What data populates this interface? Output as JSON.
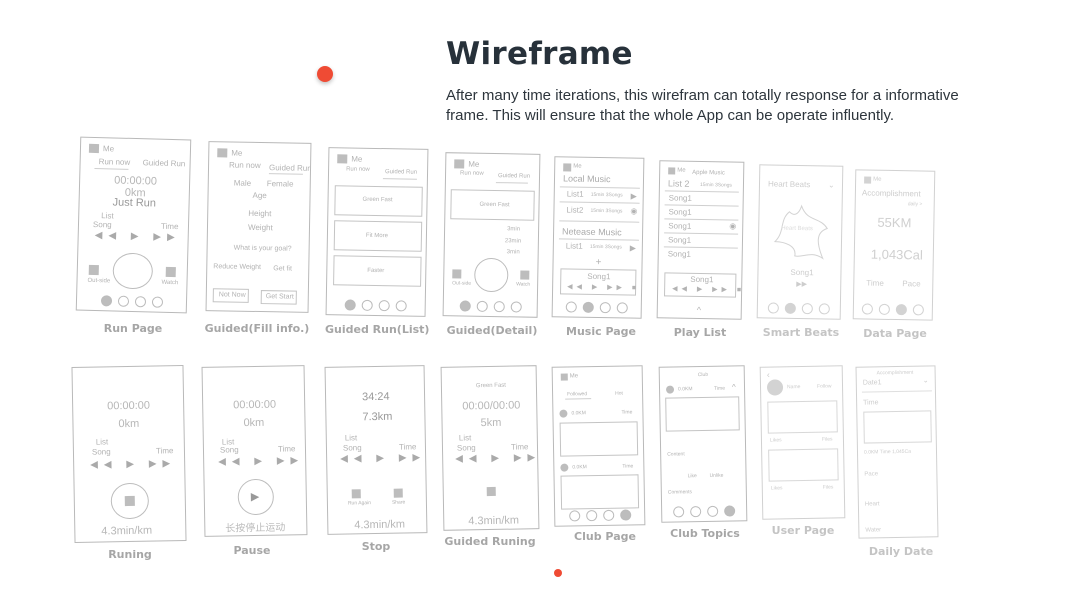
{
  "heading": {
    "title": "Wireframe",
    "description": "After many time iterations, this wirefram can totally response for a informative frame. This will ensure that the whole App can be operate influently."
  },
  "labels": {
    "run_page": "Run Page",
    "guided_fill": "Guided(Fill info.)",
    "guided_run_list": "Guided Run(List)",
    "guided_detail": "Guided(Detail)",
    "music_page": "Music Page",
    "play_list": "Play List",
    "smart_beats": "Smart Beats",
    "data_page": "Data Page",
    "runing": "Runing",
    "pause": "Pause",
    "stop": "Stop",
    "guided_runing": "Guided Runing",
    "club_page": "Club Page",
    "club_topics": "Club Topics",
    "user_page": "User Page",
    "daily_date": "Daily Date"
  },
  "screens": {
    "run": {
      "me": "Me",
      "tab1": "Run now",
      "tab2": "Guided Run",
      "timer": "00:00:00",
      "dist": "0km",
      "main": "Just Run",
      "list": "List",
      "song": "Song",
      "time": "Time",
      "outside": "Out-side",
      "watch": "Watch"
    },
    "fill": {
      "me": "Me",
      "tab1": "Run now",
      "tab2": "Guided Run",
      "male": "Male",
      "female": "Female",
      "age": "Age",
      "height": "Height",
      "weight": "Weight",
      "goal": "What is your goal?",
      "reduce": "Reduce Weight",
      "getfit": "Get fit",
      "notnow": "Not Now",
      "getstart": "Get Start"
    },
    "glist": {
      "me": "Me",
      "tab1": "Run now",
      "tab2": "Guided Run",
      "item1": "Green Fast",
      "item2": "Fit More",
      "item3": "Faster"
    },
    "gdetail": {
      "me": "Me",
      "tab1": "Run now",
      "tab2": "Guided Run",
      "item": "Green Fast",
      "v1": "3min",
      "v2": "23min",
      "v3": "3min",
      "outside": "Out-side",
      "watch": "Watch"
    },
    "music": {
      "me": "Me",
      "local": "Local Music",
      "list1": "List1",
      "list2": "List2",
      "meta": "15min 3Songs",
      "netease": "Netease Music",
      "nlist1": "List1",
      "plus": "+",
      "song": "Song1"
    },
    "playlist": {
      "me": "Me",
      "apple": "Apple Music",
      "list2": "List 2",
      "meta": "15min 3Songs",
      "songs": [
        "Song1",
        "Song1",
        "Song1",
        "Song1",
        "Song1"
      ],
      "now": "Song1"
    },
    "beats": {
      "title": "Heart Beats",
      "center": "Heart Beats",
      "song": "Song1"
    },
    "data": {
      "me": "Me",
      "title": "Accomplishment",
      "more": "daily >",
      "km": "55KM",
      "cal": "1,043Cal",
      "time": "Time",
      "pace": "Pace"
    },
    "runing": {
      "timer": "00:00:00",
      "dist": "0km",
      "list": "List",
      "song": "Song",
      "time": "Time",
      "pace": "4.3min/km"
    },
    "pause": {
      "timer": "00:00:00",
      "dist": "0km",
      "list": "List",
      "song": "Song",
      "time": "Time",
      "hint": "长按停止运动"
    },
    "stop": {
      "timer": "34:24",
      "dist": "7.3km",
      "list": "List",
      "song": "Song",
      "time": "Time",
      "again": "Run Again",
      "share": "Share",
      "pace": "4.3min/km"
    },
    "grun": {
      "item": "Green Fast",
      "timer": "00:00/00:00",
      "dist": "5km",
      "list": "List",
      "song": "Song",
      "time": "Time",
      "pace": "4.3min/km"
    },
    "club": {
      "me": "Me",
      "tab1": "Followed",
      "tab2": "Hot",
      "user": "0.0KM",
      "time": "Time"
    },
    "topics": {
      "title": "Club",
      "user": "0.0KM",
      "time": "Time",
      "content": "Content",
      "like": "Like",
      "unlike": "Unlike",
      "comments": "Comments"
    },
    "user": {
      "name": "Name",
      "follow": "Follow",
      "likes": "Likes",
      "files": "Files"
    },
    "daily": {
      "title": "Accomplishment",
      "date": "Date1",
      "time": "Time",
      "stats": "0.0KM  Time  1,045Ca",
      "pace": "Pace",
      "heart": "Heart",
      "water": "Water"
    }
  },
  "colors": {
    "accent": "#ef4b34",
    "title": "#27313a",
    "wire": "#bdbdbd"
  }
}
